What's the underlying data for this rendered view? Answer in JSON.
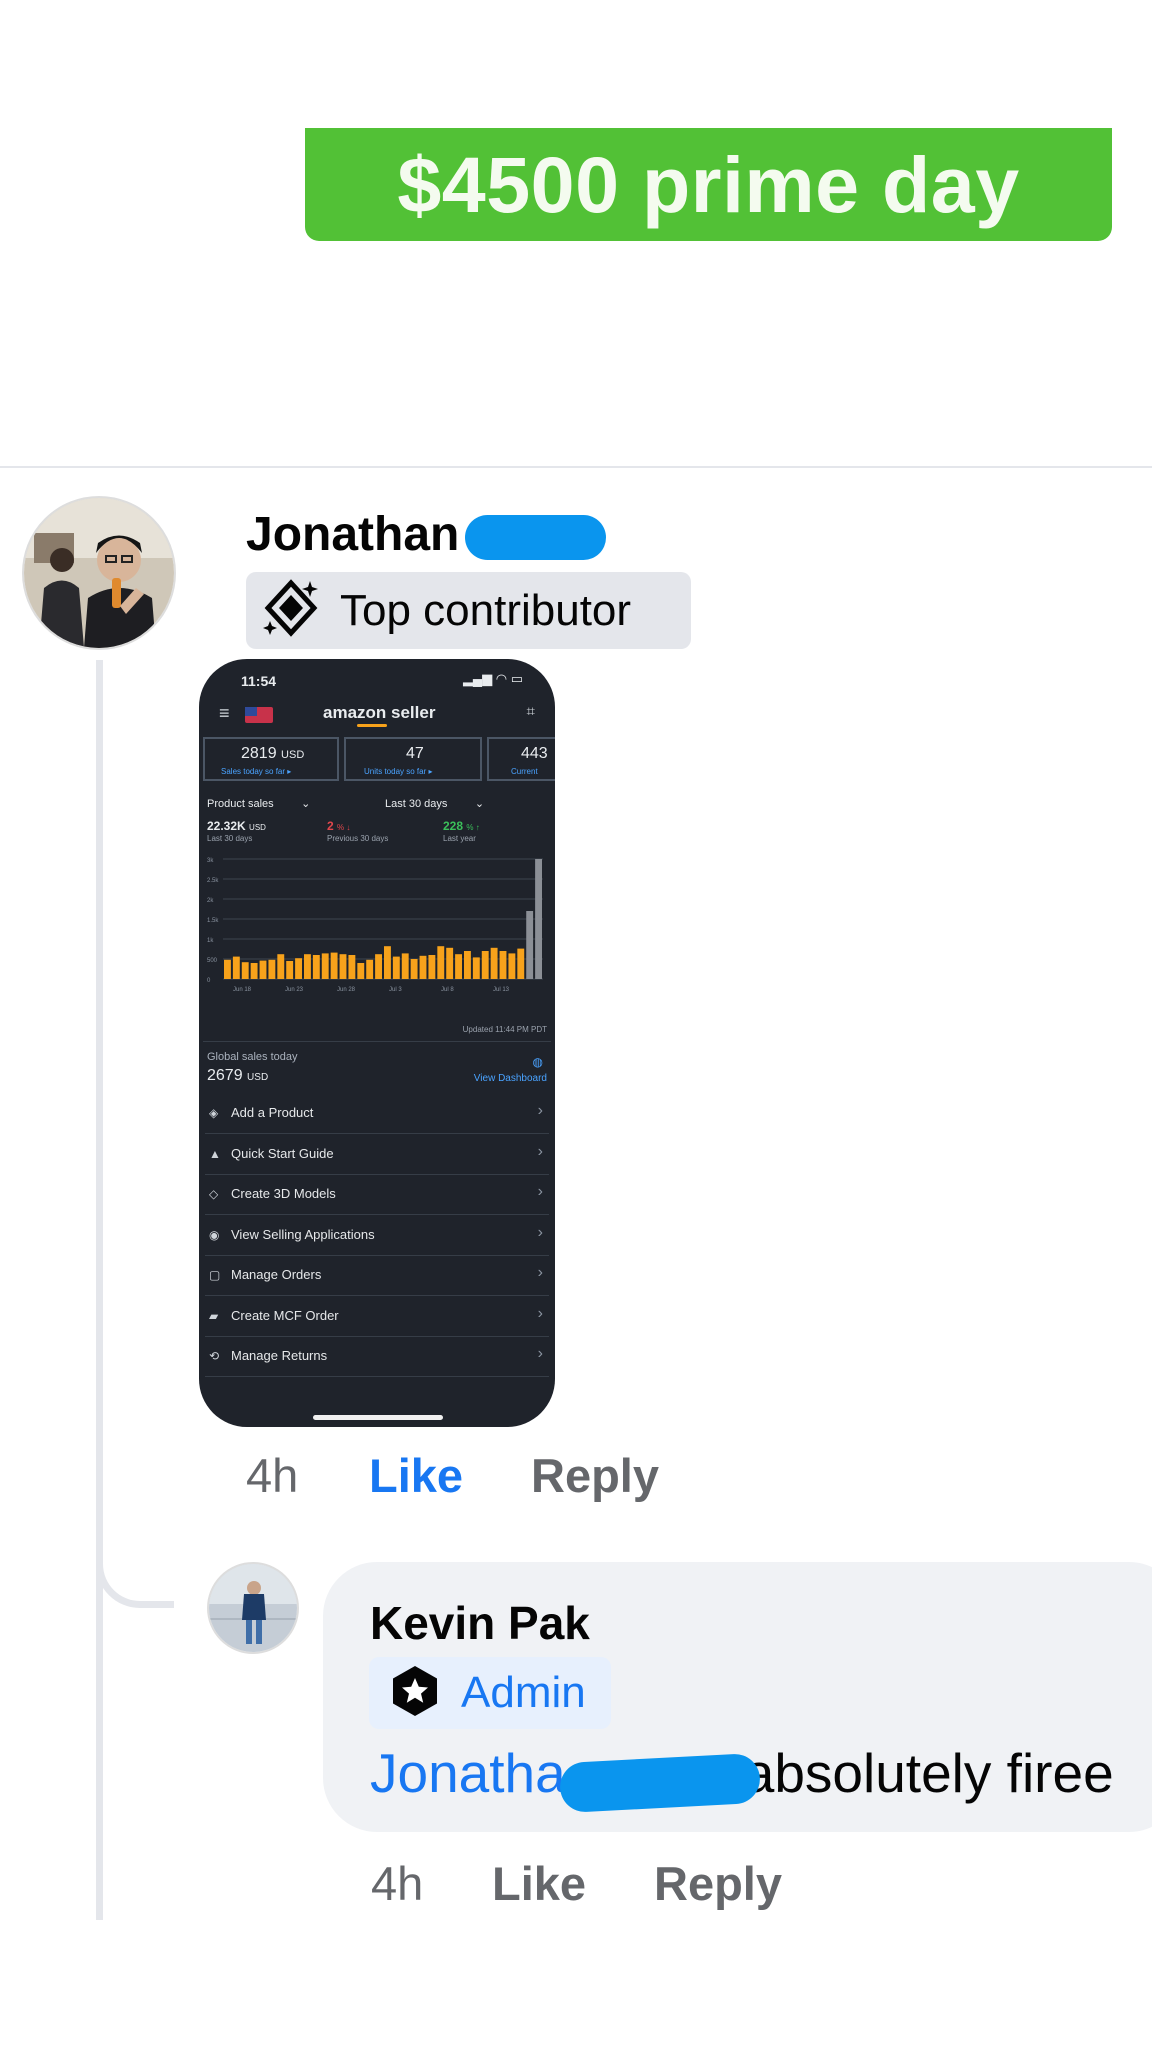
{
  "colors": {
    "banner_green": "#52c136",
    "redaction_blue": "#0a95ee",
    "link_blue": "#1877f2",
    "chart_bar_orange": "#f7a21b",
    "chart_bar_gray": "#8b8f96"
  },
  "banner": {
    "text": "$4500 prime day"
  },
  "comment": {
    "author": "Jonathan",
    "badge": {
      "icon": "top-contributor-icon",
      "label": "Top contributor"
    },
    "actions": {
      "time": "4h",
      "like": "Like",
      "reply": "Reply"
    },
    "screenshot": {
      "status_time": "11:54",
      "app_title": "amazon seller",
      "cards": [
        {
          "value": "2819",
          "unit": "USD",
          "label": "Sales today so far ▸"
        },
        {
          "value": "47",
          "unit": "",
          "label": "Units today so far ▸"
        },
        {
          "value": "443",
          "unit": "",
          "label": "Current"
        }
      ],
      "selector_left": "Product sales",
      "selector_right": "Last 30 days",
      "stats": [
        {
          "value": "22.32K",
          "unit": "USD",
          "label": "Last 30 days"
        },
        {
          "value": "2",
          "unit": "% ↓",
          "label": "Previous 30 days"
        },
        {
          "value": "228",
          "unit": "% ↑",
          "label": "Last year"
        }
      ],
      "chart": {
        "y_ticks": [
          "3k",
          "2.5k",
          "2k",
          "1.5k",
          "1k",
          "500",
          "0"
        ],
        "x_ticks": [
          "Jun 18",
          "Jun 23",
          "Jun 28",
          "Jul 3",
          "Jul 8",
          "Jul 13"
        ],
        "values": [
          480,
          560,
          420,
          400,
          460,
          480,
          620,
          450,
          520,
          620,
          600,
          640,
          660,
          620,
          600,
          400,
          480,
          620,
          820,
          560,
          640,
          500,
          580,
          600,
          820,
          780,
          620,
          700,
          540,
          700,
          780,
          700,
          640,
          760,
          1700,
          3600
        ],
        "highlight_last": 2
      },
      "updated": "Updated 11:44 PM PDT",
      "global_label": "Global sales today",
      "global_value": "2679",
      "global_unit": "USD",
      "view_dashboard": "View Dashboard",
      "menu": [
        {
          "icon": "tag-icon",
          "label": "Add a Product"
        },
        {
          "icon": "graduation-icon",
          "label": "Quick Start Guide"
        },
        {
          "icon": "cube-icon",
          "label": "Create 3D Models"
        },
        {
          "icon": "eye-icon",
          "label": "View Selling Applications"
        },
        {
          "icon": "box-icon",
          "label": "Manage Orders"
        },
        {
          "icon": "truck-icon",
          "label": "Create MCF Order"
        },
        {
          "icon": "return-icon",
          "label": "Manage Returns"
        }
      ]
    }
  },
  "reply": {
    "author": "Kevin Pak",
    "badge": {
      "icon": "admin-star-icon",
      "label": "Admin"
    },
    "mention": "Jonatha",
    "text": "absolutely firee",
    "actions": {
      "time": "4h",
      "like": "Like",
      "reply": "Reply"
    }
  }
}
